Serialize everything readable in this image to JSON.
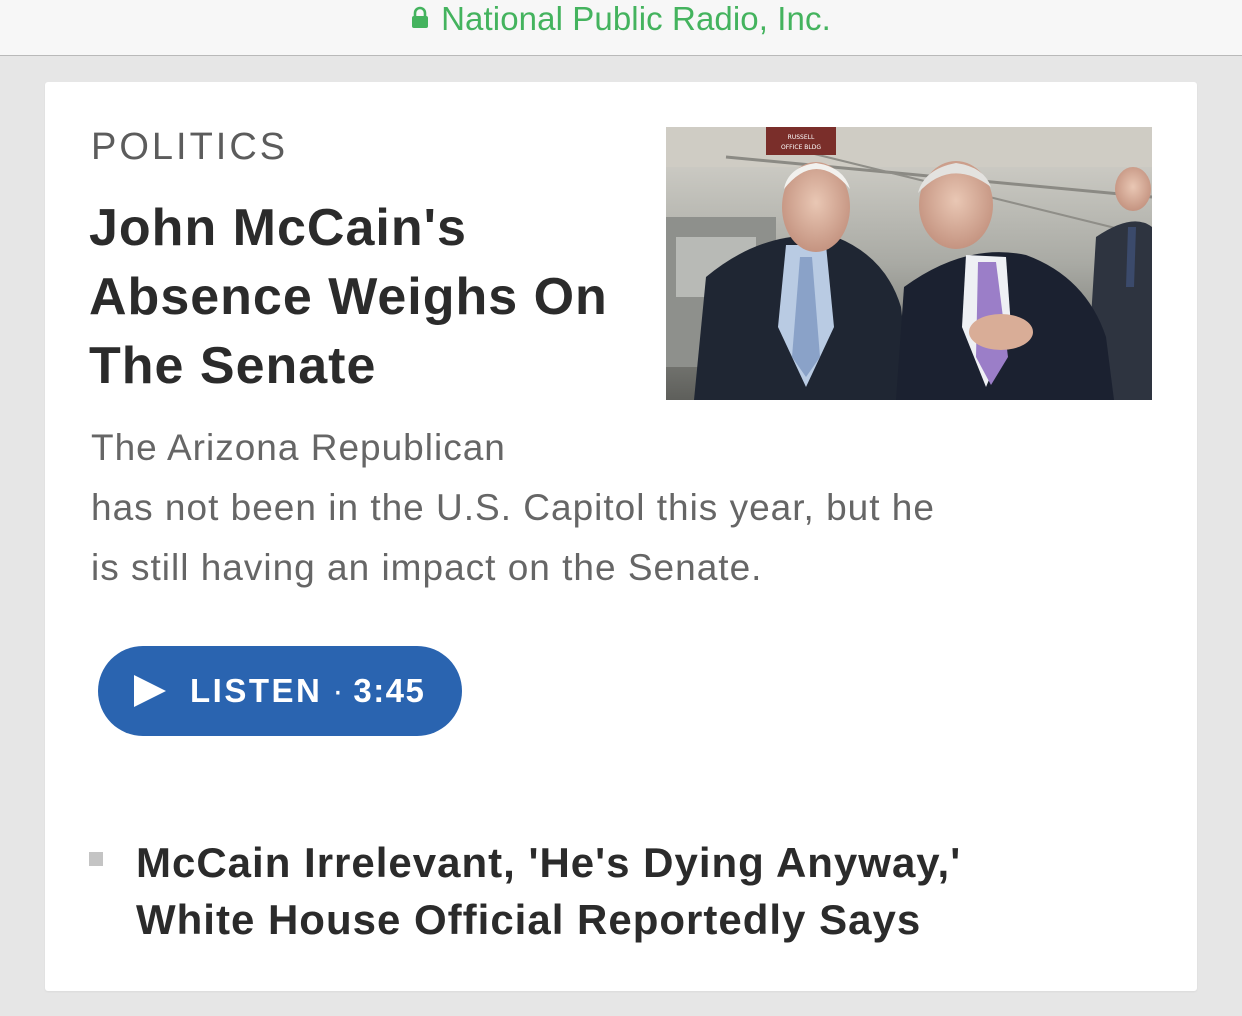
{
  "browser": {
    "url_label": "National Public Radio, Inc."
  },
  "story": {
    "section": "POLITICS",
    "headline": "John McCain's Absence Weighs On The Senate",
    "teaser_lines": [
      "The Arizona Republican",
      "has not been in the U.S. Capitol this year, but he",
      "is still having an impact on the Senate."
    ],
    "listen": {
      "label": "LISTEN",
      "separator": "·",
      "duration": "3:45"
    },
    "image": {
      "sign_lines": [
        "RUSSELL",
        "OFFICE BLDG"
      ]
    }
  },
  "related": {
    "title_lines": [
      "McCain Irrelevant, 'He's Dying Anyway,'",
      "White House Official Reportedly Says"
    ]
  },
  "colors": {
    "url_green": "#44b35e",
    "accent_blue": "#2a64b0",
    "headline": "#2b2b2b",
    "teaser": "#666666",
    "page_bg": "#e6e6e6"
  }
}
